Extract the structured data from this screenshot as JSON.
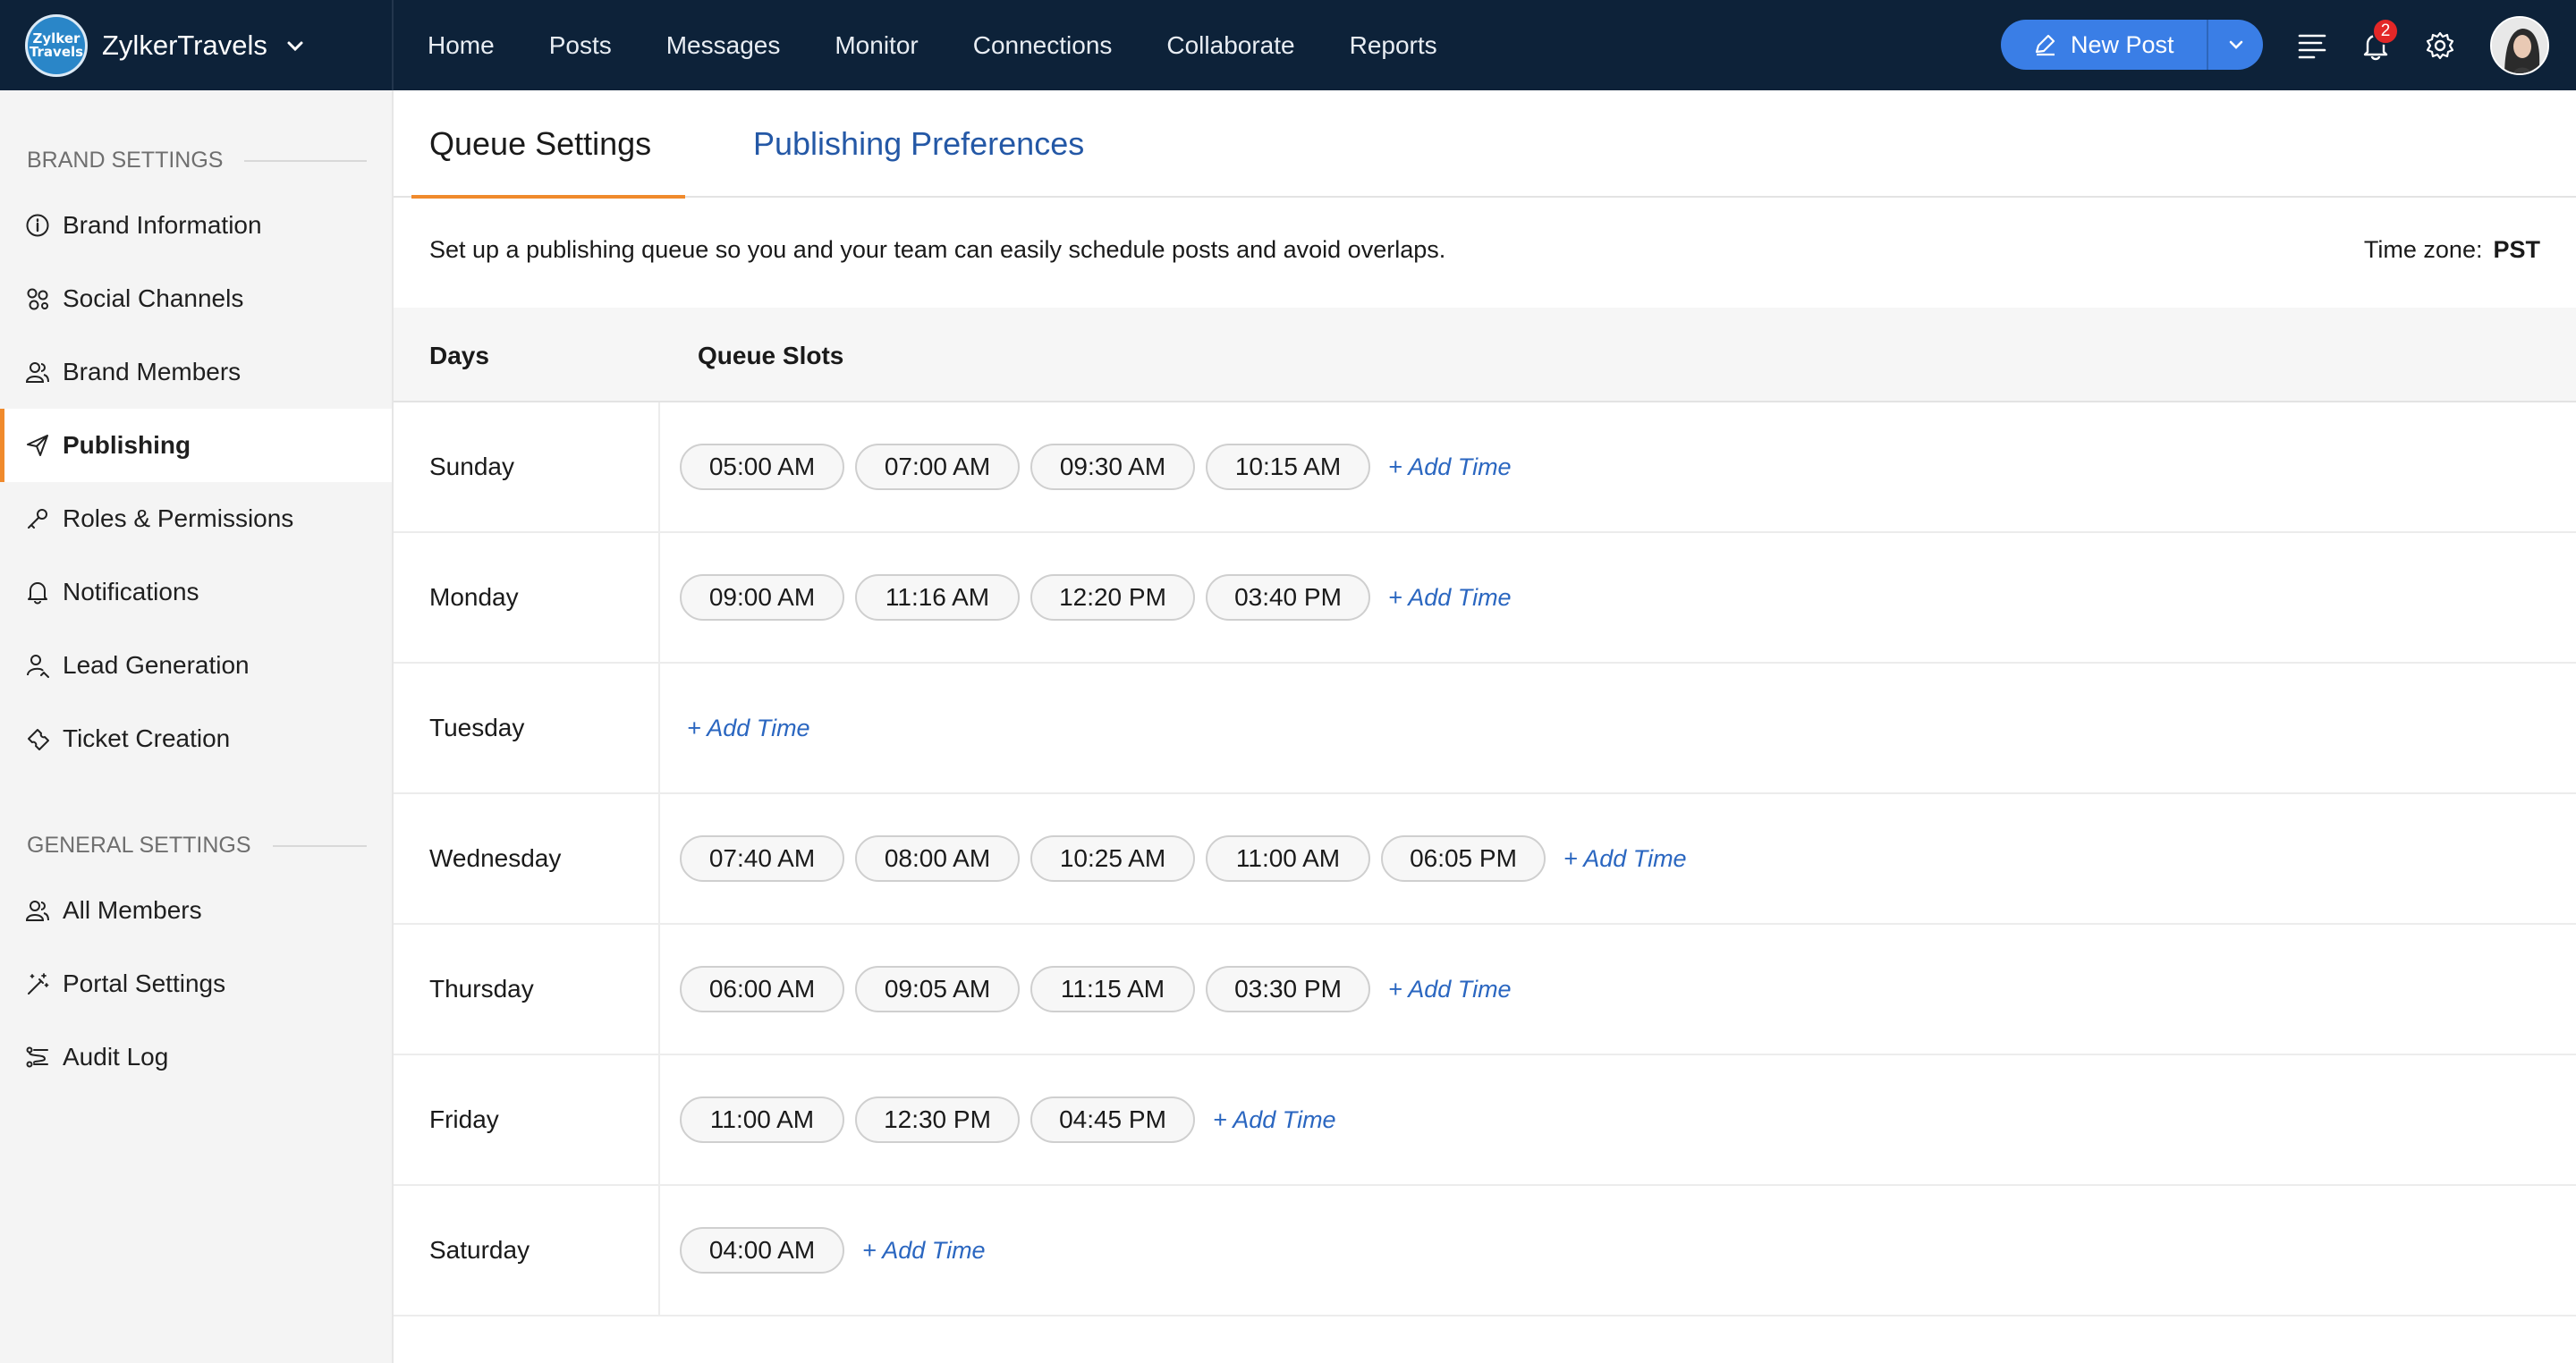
{
  "app": {
    "brand_name": "ZylkerTravels",
    "logo_text": [
      "Zylker",
      "Travels"
    ]
  },
  "nav": {
    "items": [
      "Home",
      "Posts",
      "Messages",
      "Monitor",
      "Connections",
      "Collaborate",
      "Reports"
    ]
  },
  "toolbar": {
    "new_post_label": "New Post",
    "notification_count": "2"
  },
  "sidebar": {
    "brand_settings_title": "BRAND SETTINGS",
    "brand_items": [
      {
        "label": "Brand Information",
        "icon": "info-icon"
      },
      {
        "label": "Social Channels",
        "icon": "channels-icon"
      },
      {
        "label": "Brand Members",
        "icon": "members-icon"
      },
      {
        "label": "Publishing",
        "icon": "send-icon",
        "active": true
      },
      {
        "label": "Roles & Permissions",
        "icon": "key-icon"
      },
      {
        "label": "Notifications",
        "icon": "bell-icon"
      },
      {
        "label": "Lead Generation",
        "icon": "lead-icon"
      },
      {
        "label": "Ticket Creation",
        "icon": "ticket-icon"
      }
    ],
    "general_settings_title": "GENERAL SETTINGS",
    "general_items": [
      {
        "label": "All Members",
        "icon": "members-icon"
      },
      {
        "label": "Portal Settings",
        "icon": "wand-icon"
      },
      {
        "label": "Audit Log",
        "icon": "log-icon"
      }
    ]
  },
  "tabs": {
    "queue_settings": "Queue Settings",
    "publishing_preferences": "Publishing Preferences"
  },
  "description": "Set up a publishing queue so you and your team can easily schedule posts and avoid overlaps.",
  "timezone": {
    "label": "Time zone:",
    "value": "PST"
  },
  "table": {
    "col_days": "Days",
    "col_slots": "Queue Slots",
    "add_time_label": "+ Add Time",
    "rows": [
      {
        "day": "Sunday",
        "slots": [
          "05:00 AM",
          "07:00 AM",
          "09:30 AM",
          "10:15 AM"
        ]
      },
      {
        "day": "Monday",
        "slots": [
          "09:00 AM",
          "11:16 AM",
          "12:20 PM",
          "03:40 PM"
        ]
      },
      {
        "day": "Tuesday",
        "slots": []
      },
      {
        "day": "Wednesday",
        "slots": [
          "07:40 AM",
          "08:00 AM",
          "10:25 AM",
          "11:00 AM",
          "06:05 PM"
        ]
      },
      {
        "day": "Thursday",
        "slots": [
          "06:00 AM",
          "09:05 AM",
          "11:15 AM",
          "03:30 PM"
        ]
      },
      {
        "day": "Friday",
        "slots": [
          "11:00 AM",
          "12:30 PM",
          "04:45 PM"
        ]
      },
      {
        "day": "Saturday",
        "slots": [
          "04:00 AM"
        ]
      }
    ]
  }
}
